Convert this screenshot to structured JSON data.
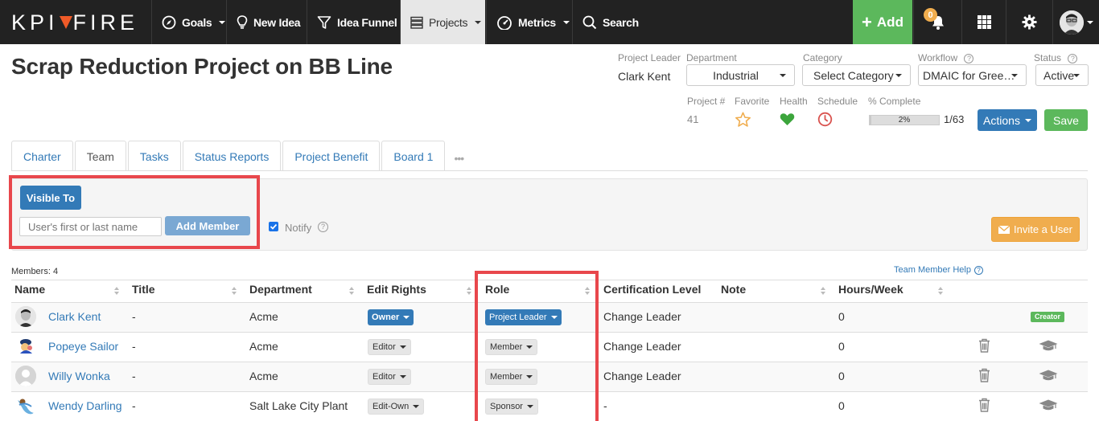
{
  "nav": {
    "logo_left": "KPI",
    "logo_right": "FIRE",
    "goals": "Goals",
    "new_idea": "New Idea",
    "idea_funnel": "Idea Funnel",
    "projects": "Projects",
    "metrics": "Metrics",
    "search": "Search",
    "add": "Add",
    "notification_count": "0"
  },
  "project": {
    "title": "Scrap Reduction Project on BB Line",
    "leader_label": "Project Leader",
    "leader": "Clark Kent",
    "department_label": "Department",
    "department": "Industrial",
    "category_label": "Category",
    "category": "Select Category",
    "workflow_label": "Workflow",
    "workflow": "DMAIC for Gree…",
    "status_label": "Status",
    "status": "Active",
    "number_label": "Project #",
    "number": "41",
    "favorite_label": "Favorite",
    "health_label": "Health",
    "schedule_label": "Schedule",
    "complete_label": "% Complete",
    "complete_value": "2%",
    "complete_fraction": 0.02,
    "tasks_count": "1/63",
    "actions": "Actions",
    "save": "Save"
  },
  "tabs": [
    "Charter",
    "Team",
    "Tasks",
    "Status Reports",
    "Project Benefit",
    "Board 1"
  ],
  "active_tab": "Team",
  "team_panel": {
    "visible_to": "Visible To",
    "user_placeholder": "User's first or last name",
    "add_member": "Add Member",
    "notify": "Notify",
    "invite": "Invite a User"
  },
  "table": {
    "members_count": "Members: 4",
    "help_link": "Team Member Help",
    "headers": {
      "name": "Name",
      "title": "Title",
      "department": "Department",
      "edit_rights": "Edit Rights",
      "role": "Role",
      "certification": "Certification Level",
      "note": "Note",
      "hours": "Hours/Week"
    },
    "rows": [
      {
        "name": "Clark Kent",
        "title": "-",
        "department": "Acme",
        "edit_rights": "Owner",
        "role": "Project Leader",
        "certification": "Change Leader",
        "hours": "0",
        "tag": "Creator"
      },
      {
        "name": "Popeye Sailor",
        "title": "-",
        "department": "Acme",
        "edit_rights": "Editor",
        "role": "Member",
        "certification": "Change Leader",
        "hours": "0",
        "tag": ""
      },
      {
        "name": "Willy Wonka",
        "title": "-",
        "department": "Acme",
        "edit_rights": "Editor",
        "role": "Member",
        "certification": "Change Leader",
        "hours": "0",
        "tag": ""
      },
      {
        "name": "Wendy Darling",
        "title": "-",
        "department": "Salt Lake City Plant",
        "edit_rights": "Edit-Own",
        "role": "Sponsor",
        "certification": "-",
        "hours": "0",
        "tag": ""
      }
    ]
  },
  "colors": {
    "nav_bg": "#222222",
    "brand_orange": "#ef5a28",
    "primary_blue": "#337ab7",
    "success_green": "#5cb85c",
    "warning_orange": "#f0ad4e",
    "highlight_red": "#e8474c"
  }
}
